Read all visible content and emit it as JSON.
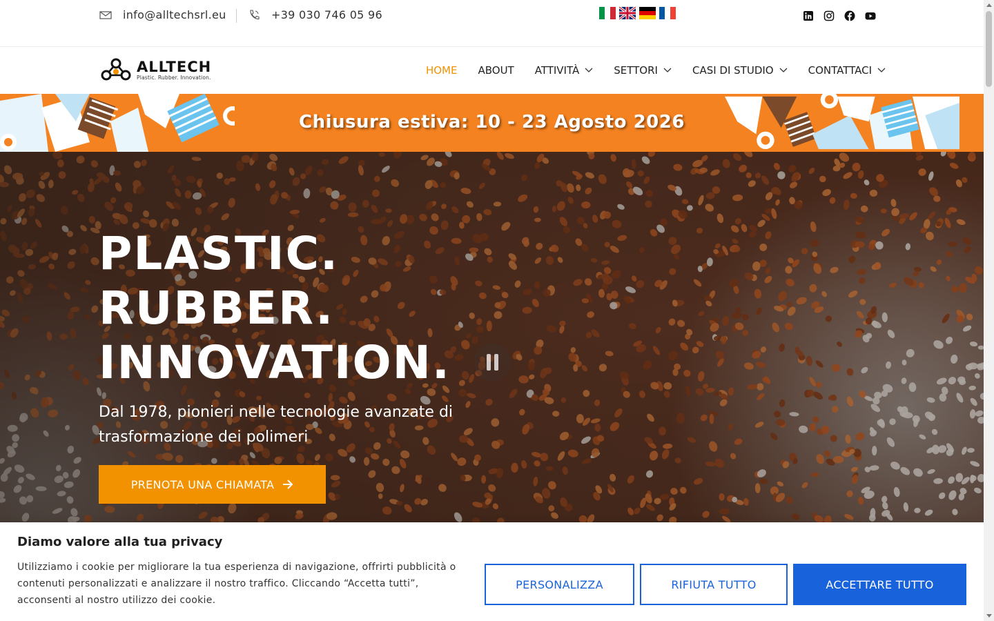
{
  "topbar": {
    "email": "info@alltechsrl.eu",
    "phone": "+39 030 746 05 96",
    "languages": [
      "Italiano",
      "English",
      "Deutsch",
      "Français"
    ],
    "socials": [
      "linkedin-icon",
      "instagram-icon",
      "facebook-icon",
      "youtube-icon"
    ]
  },
  "logo": {
    "name": "ALLTECH",
    "tagline": "Plastic. Rubber. Innovation."
  },
  "menu": {
    "items": [
      {
        "label": "HOME",
        "active": true
      },
      {
        "label": "ABOUT"
      },
      {
        "label": "ATTIVITÀ",
        "dropdown": true
      },
      {
        "label": "SETTORI",
        "dropdown": true
      },
      {
        "label": "CASI DI STUDIO",
        "dropdown": true
      },
      {
        "label": "CONTATTACI",
        "dropdown": true
      }
    ]
  },
  "banner": {
    "text": "Chiusura estiva: 10 - 23 Agosto 2026"
  },
  "hero": {
    "title_lines": [
      "PLASTIC.",
      "RUBBER.",
      "INNOVATION."
    ],
    "subtitle": "Dal 1978, pionieri nelle tecnologie avanzate di trasformazione dei polimeri",
    "cta": "PRENOTA UNA CHIAMATA"
  },
  "cookie": {
    "title": "Diamo valore alla tua privacy",
    "text": "Utilizziamo i cookie per migliorare la tua esperienza di navigazione, offrirti pubblicità o contenuti personalizzati e analizzare il nostro traffico. Cliccando “Accetta tutti”, acconsenti al nostro utilizzo dei cookie.",
    "customize": "PERSONALIZZA",
    "reject": "RIFIUTA TUTTO",
    "accept": "ACCETTARE TUTTO"
  },
  "colors": {
    "accent": "#f39200",
    "banner": "#f58220",
    "cookie_blue": "#1863dc"
  }
}
